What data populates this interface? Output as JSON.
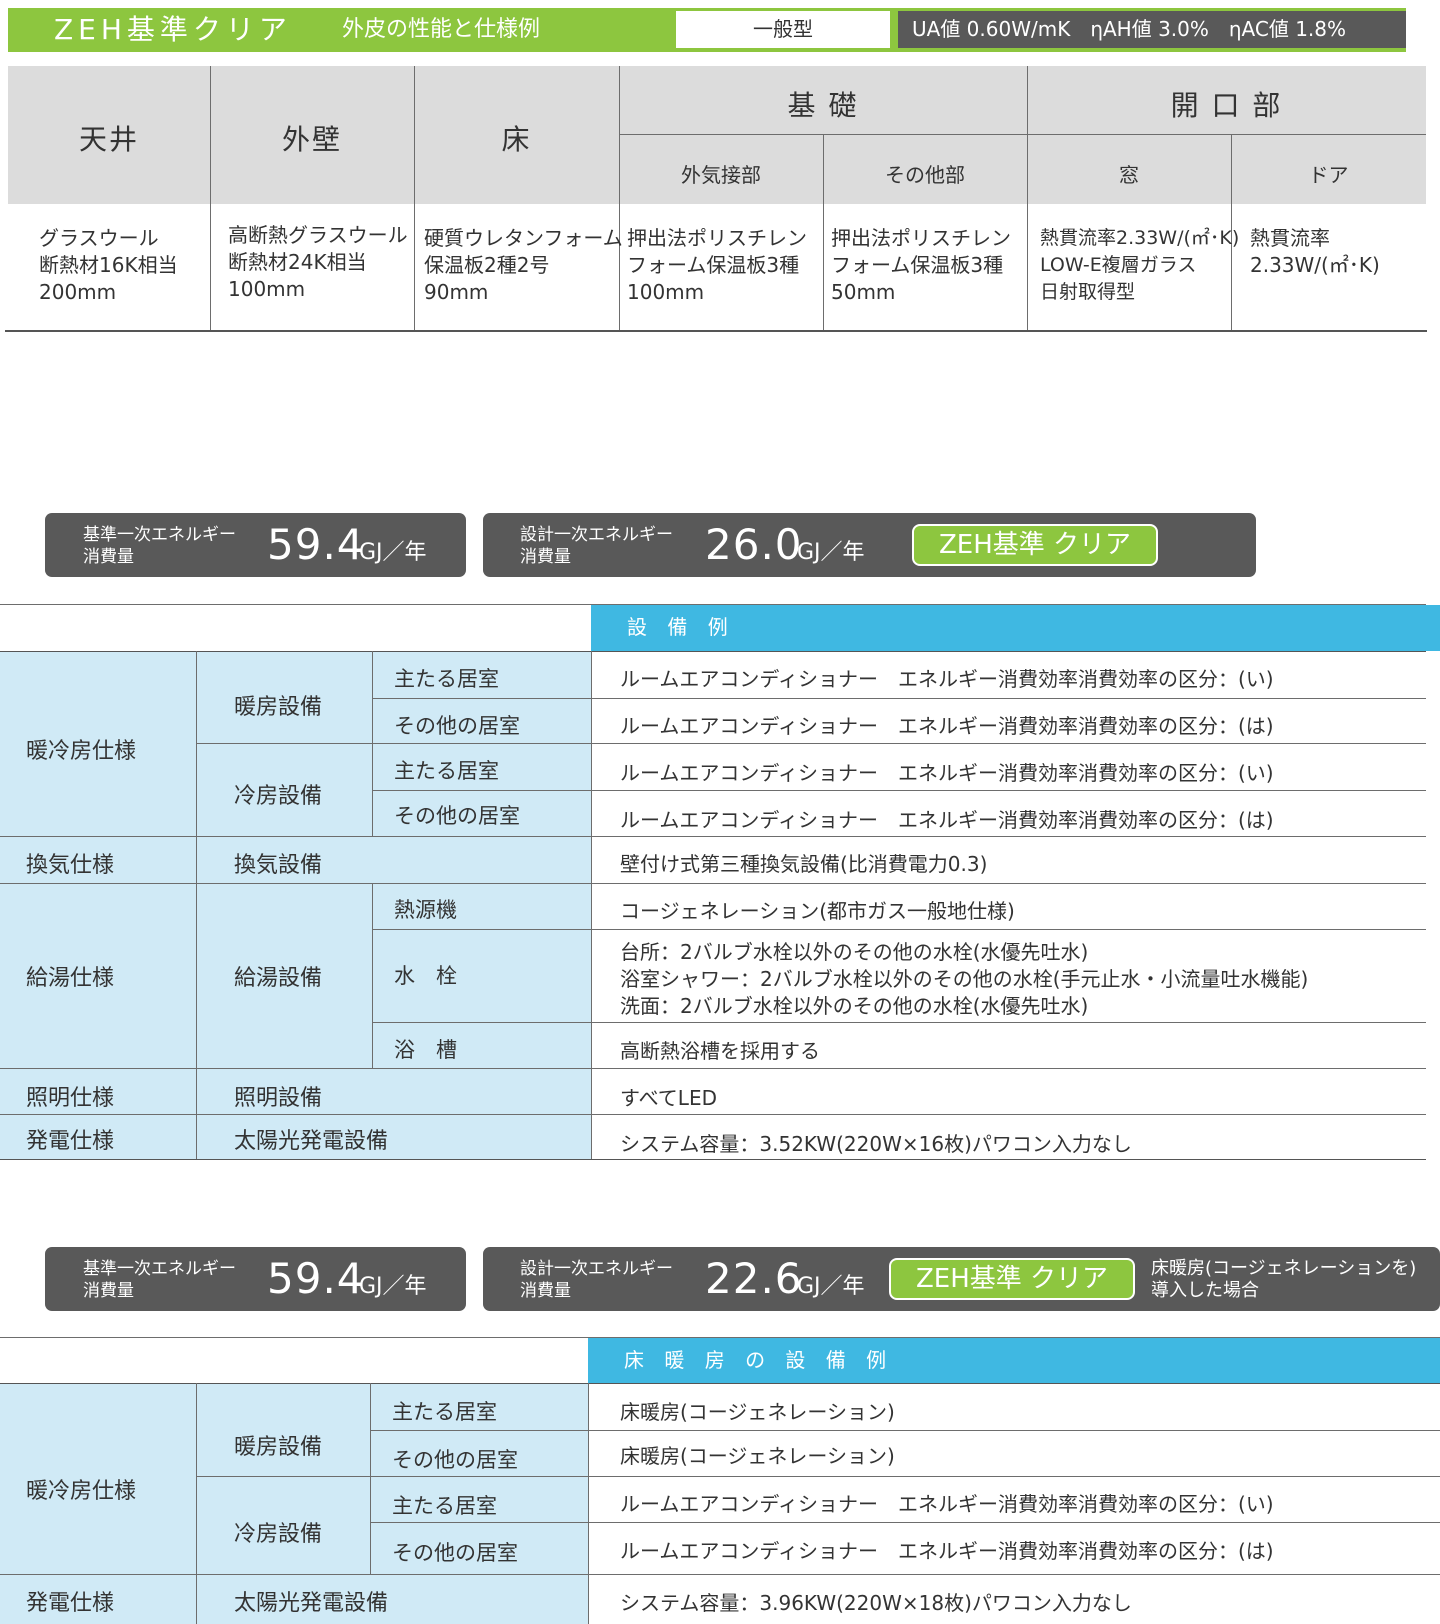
{
  "header": {
    "title": "ZEH基準クリア",
    "subtitle": "外皮の性能と仕様例",
    "type": "一般型",
    "performance": "UA値 0.60W/mK　ηAH値 3.0%　ηAC値 1.8%"
  },
  "envelope": {
    "headers": {
      "ceiling": "天井",
      "wall": "外壁",
      "floor": "床",
      "foundation": "基 礎",
      "foundation_outside": "外気接部",
      "foundation_other": "その他部",
      "opening": "開 口 部",
      "window": "窓",
      "door": "ドア"
    },
    "ceiling": [
      "グラスウール",
      "断熱材16K相当",
      "200mm"
    ],
    "wall": [
      "高断熱グラスウール",
      "断熱材24K相当",
      "100mm"
    ],
    "floor": [
      "硬質ウレタンフォーム",
      "保温板2種2号",
      "90mm"
    ],
    "foundation_outside": [
      "押出法ポリスチレン",
      "フォーム保温板3種",
      "100mm"
    ],
    "foundation_other": [
      "押出法ポリスチレン",
      "フォーム保温板3種",
      "50mm"
    ],
    "window": [
      "熱貫流率2.33W/(㎡･K)",
      "LOW-E複層ガラス",
      "日射取得型"
    ],
    "door": [
      "熱貫流率",
      "2.33W/(㎡･K)"
    ]
  },
  "energy1": {
    "standard_label": [
      "基準一次エネルギー",
      "消費量"
    ],
    "standard_value": "59.4",
    "unit": "GJ／年",
    "design_label": [
      "設計一次エネルギー",
      "消費量"
    ],
    "design_value": "26.0",
    "badge": "ZEH基準 クリア"
  },
  "equipment1": {
    "band": "設 備 例",
    "rows": {
      "cat_hvac": "暖冷房仕様",
      "heating": "暖房設備",
      "cooling": "冷房設備",
      "main_room": "主たる居室",
      "other_room": "その他の居室",
      "heat_main": "ルームエアコンディショナー　エネルギー消費効率消費効率の区分：(い)",
      "heat_other": "ルームエアコンディショナー　エネルギー消費効率消費効率の区分：(は)",
      "cool_main": "ルームエアコンディショナー　エネルギー消費効率消費効率の区分：(い)",
      "cool_other": "ルームエアコンディショナー　エネルギー消費効率消費効率の区分：(は)",
      "cat_vent": "換気仕様",
      "vent": "換気設備",
      "vent_val": "壁付け式第三種換気設備(比消費電力0.3)",
      "cat_hw": "給湯仕様",
      "hw": "給湯設備",
      "heat_source": "熱源機",
      "heat_source_val": "コージェネレーション(都市ガス一般地仕様)",
      "faucet": "水　栓",
      "faucet_vals": [
        "台所：2バルブ水栓以外のその他の水栓(水優先吐水)",
        "浴室シャワー：2バルブ水栓以外のその他の水栓(手元止水・小流量吐水機能)",
        "洗面：2バルブ水栓以外のその他の水栓(水優先吐水)"
      ],
      "bath": "浴　槽",
      "bath_val": "高断熱浴槽を採用する",
      "cat_light": "照明仕様",
      "light": "照明設備",
      "light_val": "すべてLED",
      "cat_power": "発電仕様",
      "solar": "太陽光発電設備",
      "solar_val": "システム容量：3.52KW(220W×16枚)パワコン入力なし"
    }
  },
  "energy2": {
    "standard_label": [
      "基準一次エネルギー",
      "消費量"
    ],
    "standard_value": "59.4",
    "unit": "GJ／年",
    "design_label": [
      "設計一次エネルギー",
      "消費量"
    ],
    "design_value": "22.6",
    "badge": "ZEH基準 クリア",
    "note": [
      "床暖房(コージェネレーションを)",
      "導入した場合"
    ]
  },
  "equipment2": {
    "band": "床 暖 房 の 設 備 例",
    "rows": {
      "cat_hvac": "暖冷房仕様",
      "heating": "暖房設備",
      "cooling": "冷房設備",
      "main_room": "主たる居室",
      "other_room": "その他の居室",
      "heat_main": "床暖房(コージェネレーション)",
      "heat_other": "床暖房(コージェネレーション)",
      "cool_main": "ルームエアコンディショナー　エネルギー消費効率消費効率の区分：(い)",
      "cool_other": "ルームエアコンディショナー　エネルギー消費効率消費効率の区分：(は)",
      "cat_power": "発電仕様",
      "solar": "太陽光発電設備",
      "solar_val": "システム容量：3.96KW(220W×18枚)パワコン入力なし"
    }
  }
}
